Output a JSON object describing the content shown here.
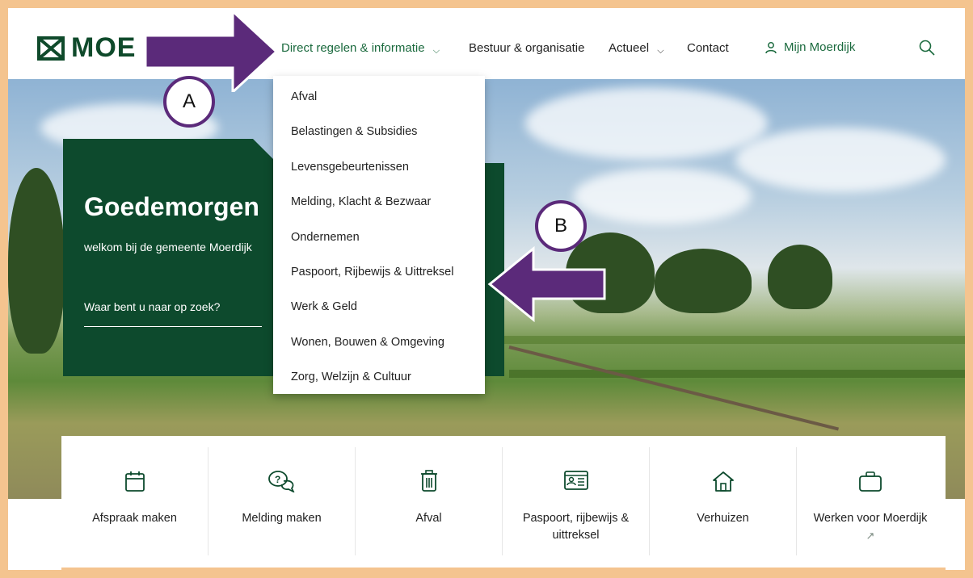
{
  "header": {
    "logo_text": "MOE",
    "nav": [
      {
        "label": "Direct regelen & informatie",
        "has_chevron": true,
        "active": true
      },
      {
        "label": "Bestuur & organisatie",
        "has_chevron": false
      },
      {
        "label": "Actueel",
        "has_chevron": true
      },
      {
        "label": "Contact",
        "has_chevron": false
      }
    ],
    "account_label": "Mijn Moerdijk",
    "icons": {
      "account": "user-icon",
      "search": "search-icon",
      "logo": "moerdijk-logo-icon"
    }
  },
  "dropdown": {
    "items": [
      "Afval",
      "Belastingen & Subsidies",
      "Levensgebeurtenissen",
      "Melding, Klacht & Bezwaar",
      "Ondernemen",
      "Paspoort, Rijbewijs & Uittreksel",
      "Werk & Geld",
      "Wonen, Bouwen & Omgeving",
      "Zorg, Welzijn & Cultuur"
    ]
  },
  "welcome": {
    "title": "Goedemorgen",
    "subtitle": "welkom bij de gemeente Moerdijk",
    "search_prompt": "Waar bent u naar op zoek?"
  },
  "quick_links": [
    {
      "label": "Afspraak maken",
      "icon": "calendar-icon"
    },
    {
      "label": "Melding maken",
      "icon": "chat-question-icon"
    },
    {
      "label": "Afval",
      "icon": "trash-icon"
    },
    {
      "label": "Paspoort, rijbewijs & uittreksel",
      "icon": "id-card-icon"
    },
    {
      "label": "Verhuizen",
      "icon": "home-icon"
    },
    {
      "label": "Werken voor Moerdijk",
      "icon": "briefcase-icon",
      "external": true
    }
  ],
  "annotations": {
    "a_label": "A",
    "b_label": "B",
    "color": "#5b2a7a"
  },
  "colors": {
    "brand_green": "#0d4a2d",
    "link_green": "#1b6a3e",
    "frame": "#f4c48f"
  }
}
